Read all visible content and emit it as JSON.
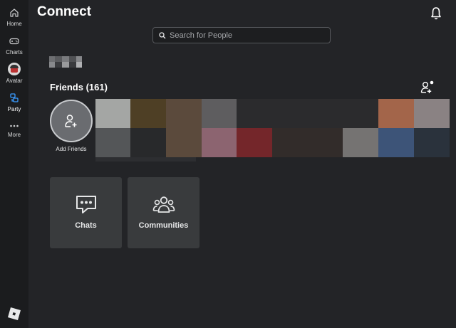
{
  "nav": {
    "items": [
      {
        "label": "Home",
        "icon": "home-icon"
      },
      {
        "label": "Charts",
        "icon": "gamepad-icon"
      },
      {
        "label": "Avatar",
        "icon": "avatar-icon"
      },
      {
        "label": "Party",
        "icon": "party-icon"
      },
      {
        "label": "More",
        "icon": "more-icon"
      }
    ]
  },
  "page": {
    "title": "Connect"
  },
  "search": {
    "placeholder": "Search for People",
    "value": ""
  },
  "friends": {
    "title": "Friends (161)",
    "add_label": "Add Friends",
    "avatar_colors": [
      "#a4a6a4",
      "#4e3f25",
      "#5b4a3c",
      "#5e5d5f",
      "#2b2b2d",
      "#2b2b2d",
      "#2b2b2d",
      "#2b2b2d",
      "#a3654a",
      "#8a8283",
      "#545658",
      "#28292b",
      "#5b4a3c",
      "#8c6470",
      "#74262a",
      "#322c2a",
      "#322c2a",
      "#757372",
      "#3d5478",
      "#2a323c"
    ]
  },
  "tiles": [
    {
      "label": "Chats",
      "icon": "chat-icon"
    },
    {
      "label": "Communities",
      "icon": "communities-icon"
    }
  ],
  "colors": {
    "background": "#232427",
    "sidebar": "#1b1c1e",
    "tile": "#393b3d",
    "accent": "#3b9bff"
  }
}
